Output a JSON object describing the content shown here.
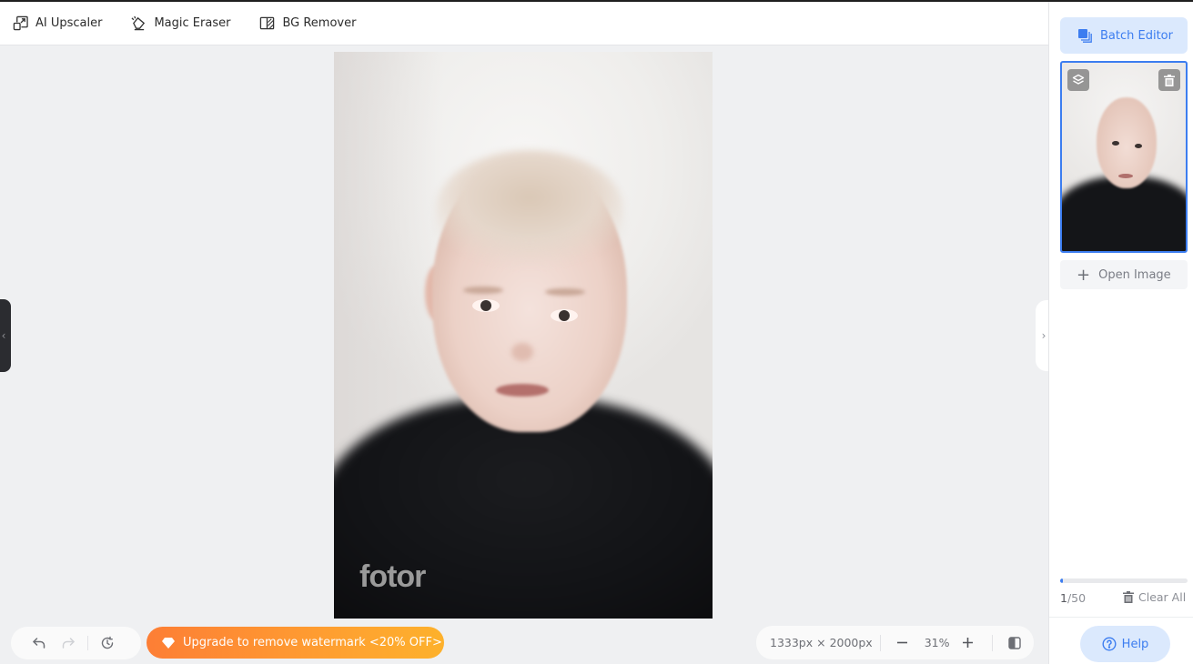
{
  "toolbar": {
    "tools": [
      {
        "label": "AI Upscaler",
        "icon": "upscale-icon"
      },
      {
        "label": "Magic Eraser",
        "icon": "eraser-icon"
      },
      {
        "label": "BG Remover",
        "icon": "bg-remover-icon"
      }
    ]
  },
  "canvas": {
    "watermark": "fotor",
    "image_alt": "Portrait of a child with short blond hair wearing a black turtleneck"
  },
  "bottom_bar": {
    "upgrade_label": "Upgrade to remove watermark <20% OFF>",
    "dimensions": "1333px × 2000px",
    "zoom_level": "31%"
  },
  "sidebar": {
    "batch_editor_label": "Batch Editor",
    "open_image_label": "Open Image",
    "count_current": "1",
    "count_total": "/50",
    "progress_fraction": 0.02,
    "clear_all_label": "Clear All",
    "help_label": "Help"
  },
  "colors": {
    "accent": "#3c7df0",
    "accent_light": "#dbe9fd",
    "upgrade_start": "#fd7e35",
    "upgrade_end": "#fdb12c"
  }
}
